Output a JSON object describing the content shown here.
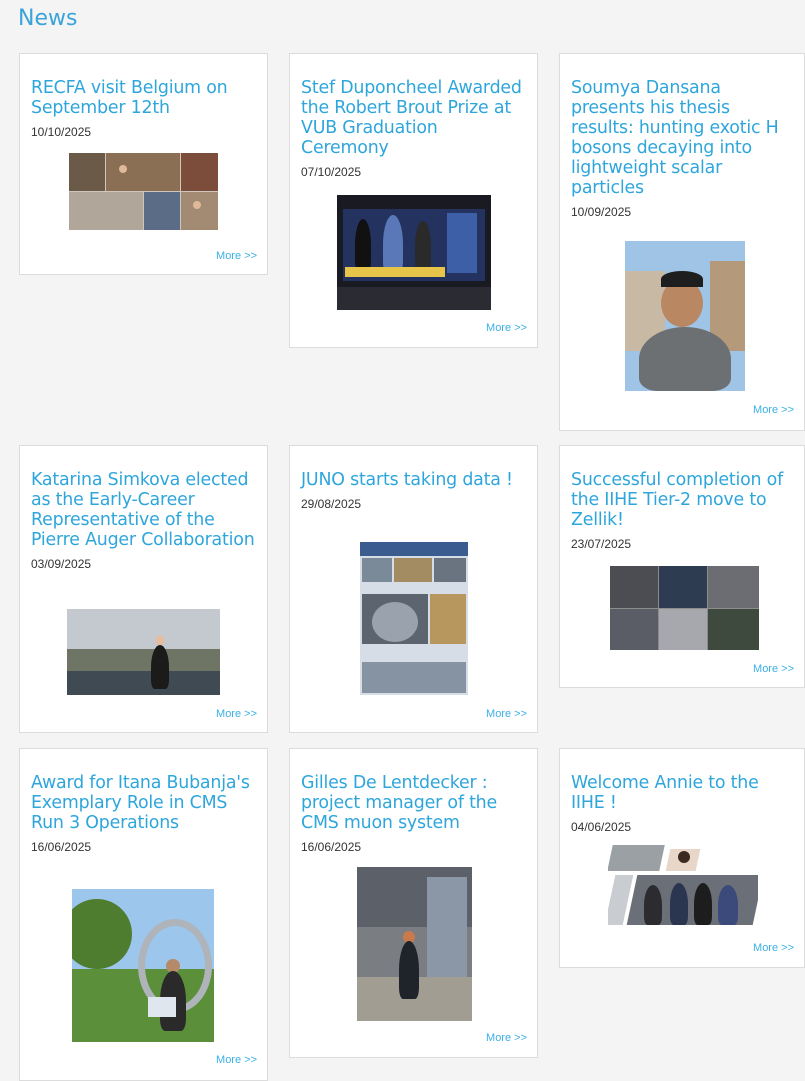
{
  "page": {
    "title": "News"
  },
  "news": [
    {
      "title": "RECFA visit Belgium on September 12th",
      "date": "10/10/2025",
      "more": "More >>",
      "image": "recfa-collage"
    },
    {
      "title": "Stef Duponcheel Awarded the Robert Brout Prize at VUB Graduation Ceremony",
      "date": "07/10/2025",
      "more": "More >>",
      "image": "graduation-screen"
    },
    {
      "title": "Soumya Dansana presents his thesis results: hunting exotic H bosons decaying into lightweight scalar particles",
      "date": "10/09/2025",
      "more": "More >>",
      "image": "portrait-city"
    },
    {
      "title": "Katarina Simkova elected as the Early-Career Representative of the Pierre Auger Collaboration",
      "date": "03/09/2025",
      "more": "More >>",
      "image": "rooftop-portrait"
    },
    {
      "title": "JUNO starts taking data !",
      "date": "29/08/2025",
      "more": "More >>",
      "image": "juno-poster"
    },
    {
      "title": "Successful completion of the IIHE Tier-2 move to Zellik!",
      "date": "23/07/2025",
      "more": "More >>",
      "image": "datacenter-collage"
    },
    {
      "title": "Award for Itana Bubanja's Exemplary Role in CMS Run 3 Operations",
      "date": "16/06/2025",
      "more": "More >>",
      "image": "sculpture-portrait"
    },
    {
      "title": "Gilles De Lentdecker : project manager of the CMS muon system",
      "date": "16/06/2025",
      "more": "More >>",
      "image": "cms-hall"
    },
    {
      "title": "Welcome Annie to the IIHE !",
      "date": "04/06/2025",
      "more": "More >>",
      "image": "team-collage"
    }
  ]
}
